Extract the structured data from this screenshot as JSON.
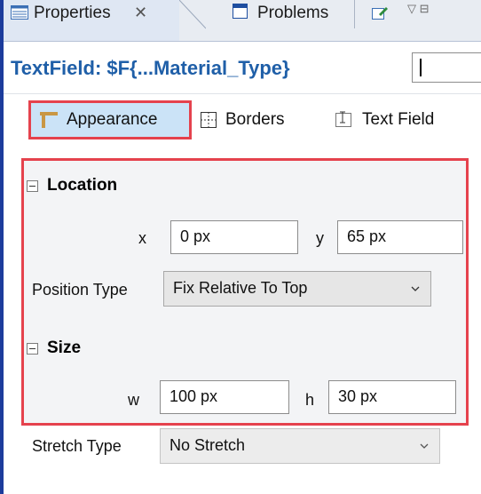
{
  "tabs": {
    "properties_label": "Properties",
    "problems_label": "Problems"
  },
  "header": {
    "title": "TextField: $F{...Material_Type}",
    "input_value": ""
  },
  "subtabs": {
    "appearance": "Appearance",
    "borders": "Borders",
    "text_field": "Text Field"
  },
  "location": {
    "heading": "Location",
    "x_label": "x",
    "x_value": "0 px",
    "y_label": "y",
    "y_value": "65 px",
    "position_type_label": "Position Type",
    "position_type_value": "Fix Relative To Top"
  },
  "size": {
    "heading": "Size",
    "w_label": "w",
    "w_value": "100 px",
    "h_label": "h",
    "h_value": "30 px"
  },
  "stretch": {
    "label": "Stretch Type",
    "value": "No Stretch"
  },
  "colors": {
    "accent_title": "#1f5fa8",
    "highlight_red": "#e5424d",
    "appearance_tab_bg": "#cbe3f7",
    "window_border": "#1c3c9c"
  },
  "icons": [
    "properties-grid-icon",
    "close-icon",
    "problems-icon",
    "edit-icon",
    "view-menu-icon",
    "appearance-icon",
    "borders-icon",
    "text-field-icon",
    "collapse-icon",
    "chevron-down-icon"
  ]
}
